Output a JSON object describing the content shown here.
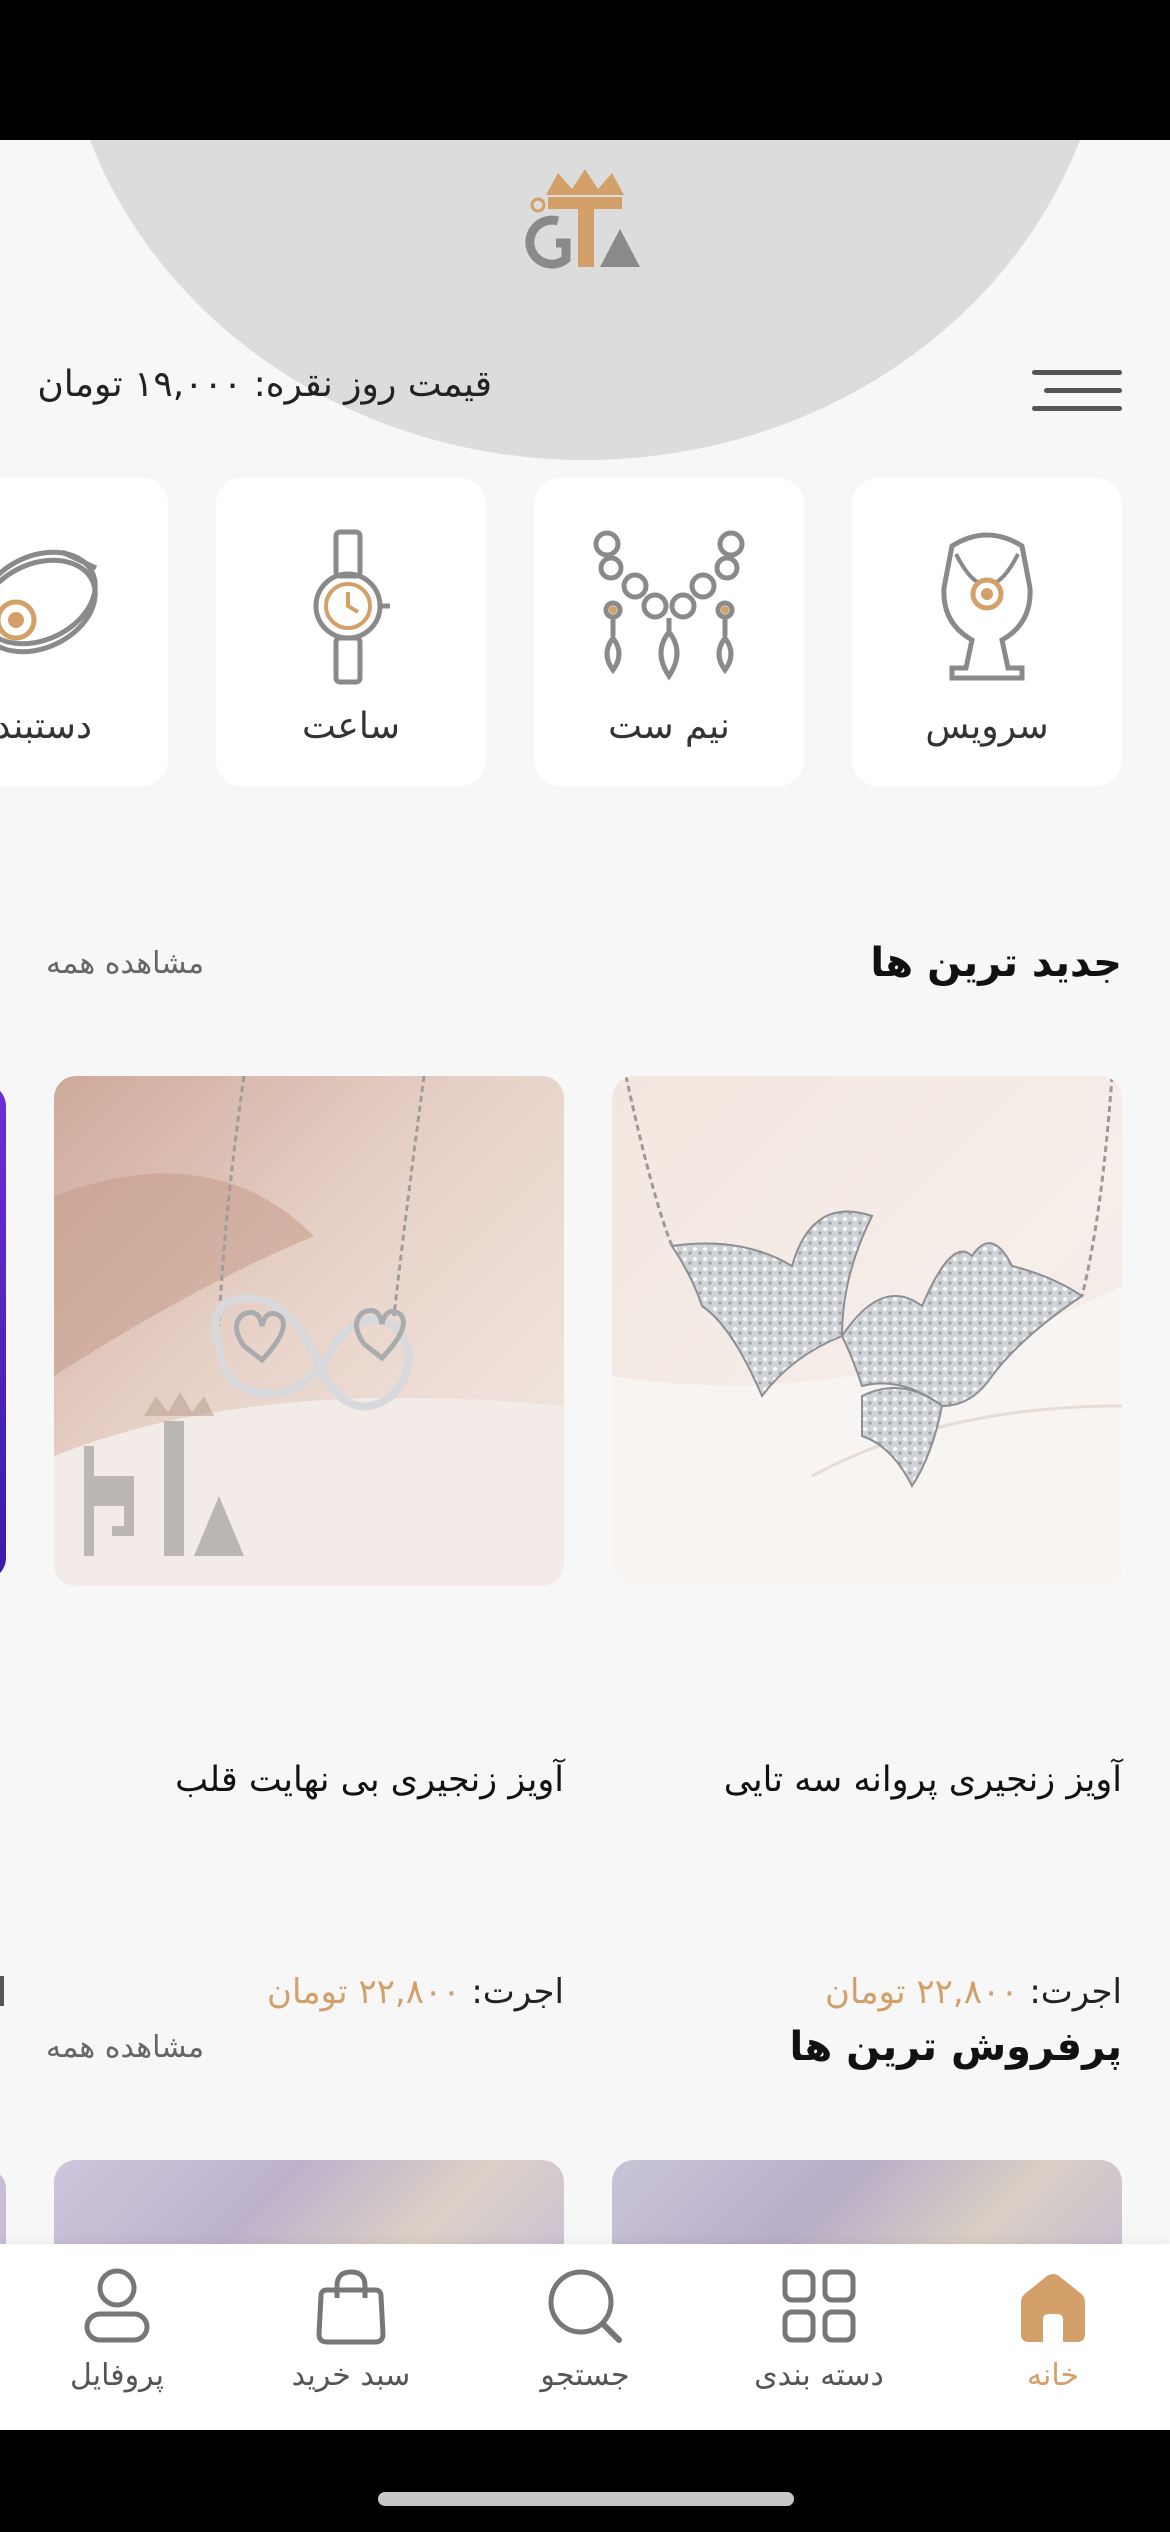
{
  "header": {
    "price_label": "قیمت روز نقره:",
    "price_value": "۱۹,۰۰۰ تومان"
  },
  "categories": [
    {
      "label": "سرویس",
      "icon": "necklace-bust-icon"
    },
    {
      "label": "نیم ست",
      "icon": "jewelry-set-icon"
    },
    {
      "label": "ساعت",
      "icon": "watch-icon"
    },
    {
      "label": "دستبند",
      "icon": "bracelet-icon"
    }
  ],
  "newest": {
    "title": "جدید ترین ها",
    "see_all": "مشاهده همه",
    "products": [
      {
        "name": "آویز زنجیری پروانه سه تایی",
        "fee_label": "اجرت:",
        "fee_value": "۲۲,۸۰۰ تومان"
      },
      {
        "name": "آویز زنجیری بی نهایت قلب",
        "fee_label": "اجرت:",
        "fee_value": "۲۲,۸۰۰ تومان"
      }
    ]
  },
  "bestsellers": {
    "title": "پرفروش ترین ها",
    "see_all": "مشاهده همه"
  },
  "tabbar": {
    "items": [
      {
        "label": "خانه",
        "icon": "home-icon",
        "active": true
      },
      {
        "label": "دسته بندی",
        "icon": "grid-icon",
        "active": false
      },
      {
        "label": "جستجو",
        "icon": "search-icon",
        "active": false
      },
      {
        "label": "سبد خرید",
        "icon": "shopping-bag-icon",
        "active": false
      },
      {
        "label": "پروفایل",
        "icon": "profile-icon",
        "active": false
      }
    ]
  },
  "colors": {
    "accent": "#d4a06a",
    "background": "#f7f7f7",
    "card": "#ffffff"
  }
}
